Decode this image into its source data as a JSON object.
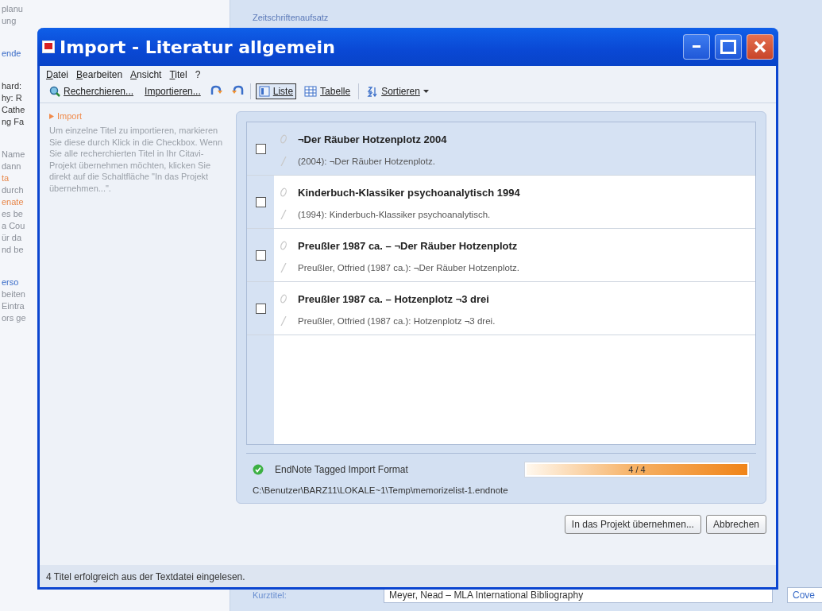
{
  "background": {
    "left_groups": [
      {
        "lines": [
          {
            "text": "planu",
            "kind": "plain"
          },
          {
            "text": "ung",
            "kind": "plain"
          }
        ]
      },
      {
        "lines": [
          {
            "text": "ende",
            "kind": "link"
          }
        ]
      },
      {
        "lines": [
          {
            "text": "hard:",
            "kind": "dark"
          },
          {
            "text": "hy: R",
            "kind": "dark"
          },
          {
            "text": "Cathe",
            "kind": "dark"
          },
          {
            "text": "ng Fa",
            "kind": "dark"
          }
        ]
      },
      {
        "lines": [
          {
            "text": "Name",
            "kind": "plain"
          },
          {
            "text": "dann",
            "kind": "plain"
          },
          {
            "text": "ta",
            "kind": "accent"
          },
          {
            "text": "durch",
            "kind": "plain"
          },
          {
            "text": "enate",
            "kind": "accent"
          },
          {
            "text": "es be",
            "kind": "plain"
          },
          {
            "text": "a Cou",
            "kind": "plain"
          },
          {
            "text": "ür da",
            "kind": "plain"
          },
          {
            "text": "nd be",
            "kind": "plain"
          }
        ]
      },
      {
        "lines": [
          {
            "text": "erso",
            "kind": "link"
          },
          {
            "text": "beiten",
            "kind": "plain"
          },
          {
            "text": "Eintra",
            "kind": "plain"
          },
          {
            "text": "ors ge",
            "kind": "plain"
          }
        ]
      }
    ],
    "section_title": "Zeitschriftenaufsatz",
    "short_title_label": "Kurztitel:",
    "short_title_value": "Meyer, Nead – MLA International Bibliography",
    "field_3": "Cove"
  },
  "window": {
    "title": "Import - Literatur allgemein"
  },
  "menu": [
    "Datei",
    "Bearbeiten",
    "Ansicht",
    "Titel",
    "?"
  ],
  "toolbar": [
    {
      "kind": "search",
      "label": "Recherchieren..."
    },
    {
      "kind": "text",
      "label": "Importieren..."
    },
    {
      "kind": "undo"
    },
    {
      "kind": "redo"
    },
    {
      "kind": "separator"
    },
    {
      "kind": "listview",
      "label": "Liste",
      "selected": true
    },
    {
      "kind": "tableview",
      "label": "Tabelle",
      "selected": false
    },
    {
      "kind": "separator"
    },
    {
      "kind": "sort",
      "label": "Sortieren"
    }
  ],
  "help": {
    "heading": "Import",
    "text": "Um einzelne Titel zu importieren, markieren Sie diese durch Klick in die Checkbox. Wenn Sie alle recherchierten Titel in Ihr Citavi-Projekt übernehmen möchten, klicken Sie direkt auf die Schaltfläche \"In das Projekt übernehmen...\"."
  },
  "titles": [
    {
      "title": "¬Der Räuber Hotzenplotz 2004",
      "citation": "(2004): ¬Der Räuber Hotzenplotz.",
      "checked": false,
      "selected": true
    },
    {
      "title": "Kinderbuch-Klassiker psychoanalytisch 1994",
      "citation": "(1994): Kinderbuch-Klassiker psychoanalytisch.",
      "checked": false,
      "selected": false
    },
    {
      "title": "Preußler 1987 ca. – ¬Der Räuber Hotzenplotz",
      "citation": "Preußler, Otfried (1987 ca.): ¬Der Räuber Hotzenplotz.",
      "checked": false,
      "selected": false
    },
    {
      "title": "Preußler 1987 ca. – Hotzenplotz ¬3 drei",
      "citation": "Preußler, Otfried (1987 ca.): Hotzenplotz ¬3 drei.",
      "checked": false,
      "selected": false
    }
  ],
  "import_status": {
    "format": "EndNote Tagged Import Format",
    "level": 1,
    "progress_label": "4 / 4",
    "path": "C:\\Benutzer\\BARZ11\\LOKALE~1\\Temp\\memorizelist-1.endnote"
  },
  "buttons": [
    "In das Projekt übernehmen...",
    "Abbrechen"
  ],
  "status_bar": "4 Titel erfolgreich aus der Textdatei eingelesen."
}
